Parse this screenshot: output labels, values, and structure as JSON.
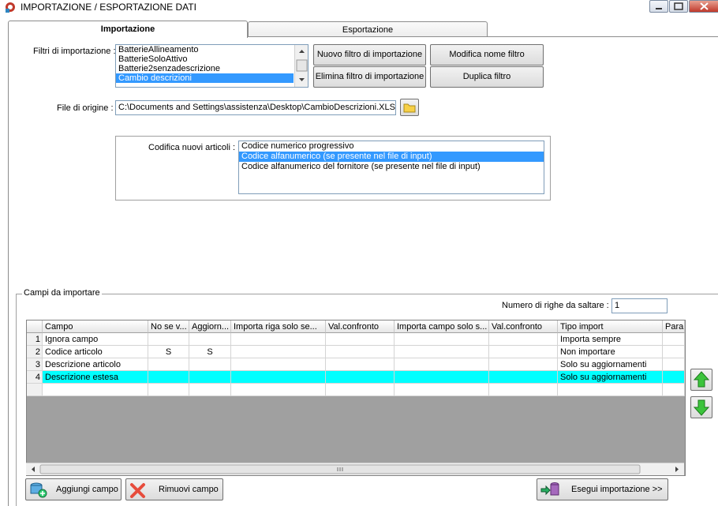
{
  "window": {
    "title": "IMPORTAZIONE / ESPORTAZIONE DATI"
  },
  "tabs": [
    {
      "label": "Importazione"
    },
    {
      "label": "Esportazione"
    }
  ],
  "filters": {
    "label": "Filtri di importazione :",
    "items": [
      "BatterieAllineamento",
      "BatterieSoloAttivo",
      "Batterie2senzadescrizione",
      "Cambio descrizioni"
    ],
    "selected_index": 3
  },
  "buttons": {
    "new_filter": "Nuovo filtro di importazione",
    "rename_filter": "Modifica nome filtro",
    "delete_filter": "Elimina filtro di importazione",
    "duplicate_filter": "Duplica filtro",
    "add_field": "Aggiungi campo",
    "remove_field": "Rimuovi campo",
    "run_import": "Esegui importazione >>"
  },
  "source_file": {
    "label": "File di origine :",
    "value": "C:\\Documents and Settings\\assistenza\\Desktop\\CambioDescrizioni.XLS"
  },
  "coding": {
    "label": "Codifica nuovi articoli :",
    "options": [
      "Codice numerico progressivo",
      "Codice alfanumerico (se presente nel file di input)",
      "Codice alfanumerico del fornitore (se presente nel file di input)"
    ],
    "selected_index": 1
  },
  "fields_section": {
    "label": "Campi da importare",
    "skip_rows_label": "Numero di righe da saltare  :",
    "skip_rows_value": "1"
  },
  "grid": {
    "columns": [
      "Campo",
      "No se v...",
      "Aggiorn...",
      "Importa riga solo se...",
      "Val.confronto",
      "Importa campo solo s...",
      "Val.confronto",
      "Tipo import",
      "Para"
    ],
    "rows": [
      {
        "n": "1",
        "campo": "Ignora campo",
        "no_se": "",
        "aggiorn": "",
        "tipo": "Importa sempre"
      },
      {
        "n": "2",
        "campo": "Codice articolo",
        "no_se": "S",
        "aggiorn": "S",
        "tipo": "Non importare"
      },
      {
        "n": "3",
        "campo": "Descrizione articolo",
        "no_se": "",
        "aggiorn": "",
        "tipo": "Solo su aggiornamenti"
      },
      {
        "n": "4",
        "campo": "Descrizione estesa",
        "no_se": "",
        "aggiorn": "",
        "tipo": "Solo su aggiornamenti"
      }
    ],
    "highlight_row": 3
  },
  "colors": {
    "selection": "#3399ff",
    "row_highlight": "#00ffff",
    "empty_grid": "#a0a0a0"
  }
}
